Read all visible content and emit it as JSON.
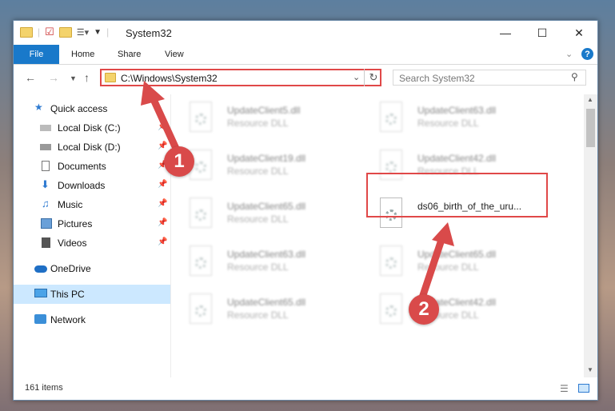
{
  "window": {
    "title": "System32"
  },
  "ribbon": {
    "tabs": [
      "File",
      "Home",
      "Share",
      "View"
    ]
  },
  "address": {
    "path": "C:\\Windows\\System32"
  },
  "search": {
    "placeholder": "Search System32"
  },
  "sidebar": {
    "items": [
      {
        "label": "Quick access",
        "icon": "star-icon",
        "pinned": false
      },
      {
        "label": "Local Disk (C:)",
        "icon": "disk-icon",
        "pinned": true
      },
      {
        "label": "Local Disk (D:)",
        "icon": "disk-icon",
        "pinned": true
      },
      {
        "label": "Documents",
        "icon": "document-icon",
        "pinned": true
      },
      {
        "label": "Downloads",
        "icon": "download-icon",
        "pinned": true
      },
      {
        "label": "Music",
        "icon": "music-icon",
        "pinned": true
      },
      {
        "label": "Pictures",
        "icon": "picture-icon",
        "pinned": true
      },
      {
        "label": "Videos",
        "icon": "video-icon",
        "pinned": true
      },
      {
        "label": "OneDrive",
        "icon": "cloud-icon",
        "pinned": false
      },
      {
        "label": "This PC",
        "icon": "computer-icon",
        "pinned": false,
        "selected": true
      },
      {
        "label": "Network",
        "icon": "network-icon",
        "pinned": false
      }
    ]
  },
  "files": [
    {
      "name": "UpdateClient5.dll",
      "type": "Resource DLL",
      "blurred": true
    },
    {
      "name": "UpdateClient63.dll",
      "type": "Resource DLL",
      "blurred": true
    },
    {
      "name": "UpdateClient19.dll",
      "type": "Resource DLL",
      "blurred": true
    },
    {
      "name": "UpdateClient42.dll",
      "type": "Resource DLL",
      "blurred": true
    },
    {
      "name": "UpdateClient65.dll",
      "type": "Resource DLL",
      "blurred": true
    },
    {
      "name": "ds06_birth_of_the_uru...",
      "type": "",
      "blurred": false
    },
    {
      "name": "UpdateClient63.dll",
      "type": "Resource DLL",
      "blurred": true
    },
    {
      "name": "UpdateClient65.dll",
      "type": "Resource DLL",
      "blurred": true
    },
    {
      "name": "UpdateClient65.dll",
      "type": "Resource DLL",
      "blurred": true
    },
    {
      "name": "UpdateClient42.dll",
      "type": "Resource DLL",
      "blurred": true
    }
  ],
  "status": {
    "item_count": "161 items"
  },
  "callouts": [
    "1",
    "2"
  ],
  "colors": {
    "accent": "#1979ca",
    "highlight": "#e04848",
    "selected": "#cce8ff"
  }
}
